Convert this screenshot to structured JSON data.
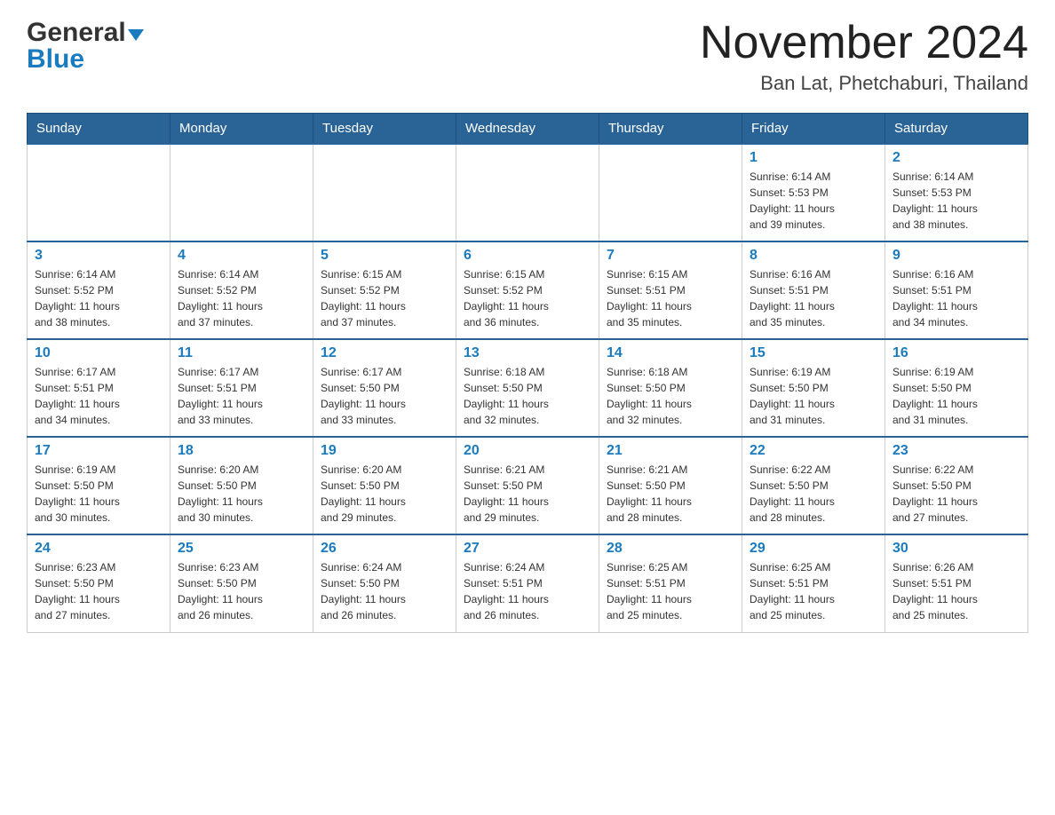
{
  "header": {
    "logo_line1": "General",
    "logo_line2": "Blue",
    "main_title": "November 2024",
    "subtitle": "Ban Lat, Phetchaburi, Thailand"
  },
  "days_of_week": [
    "Sunday",
    "Monday",
    "Tuesday",
    "Wednesday",
    "Thursday",
    "Friday",
    "Saturday"
  ],
  "weeks": [
    {
      "days": [
        {
          "number": "",
          "info": ""
        },
        {
          "number": "",
          "info": ""
        },
        {
          "number": "",
          "info": ""
        },
        {
          "number": "",
          "info": ""
        },
        {
          "number": "",
          "info": ""
        },
        {
          "number": "1",
          "info": "Sunrise: 6:14 AM\nSunset: 5:53 PM\nDaylight: 11 hours\nand 39 minutes."
        },
        {
          "number": "2",
          "info": "Sunrise: 6:14 AM\nSunset: 5:53 PM\nDaylight: 11 hours\nand 38 minutes."
        }
      ]
    },
    {
      "days": [
        {
          "number": "3",
          "info": "Sunrise: 6:14 AM\nSunset: 5:52 PM\nDaylight: 11 hours\nand 38 minutes."
        },
        {
          "number": "4",
          "info": "Sunrise: 6:14 AM\nSunset: 5:52 PM\nDaylight: 11 hours\nand 37 minutes."
        },
        {
          "number": "5",
          "info": "Sunrise: 6:15 AM\nSunset: 5:52 PM\nDaylight: 11 hours\nand 37 minutes."
        },
        {
          "number": "6",
          "info": "Sunrise: 6:15 AM\nSunset: 5:52 PM\nDaylight: 11 hours\nand 36 minutes."
        },
        {
          "number": "7",
          "info": "Sunrise: 6:15 AM\nSunset: 5:51 PM\nDaylight: 11 hours\nand 35 minutes."
        },
        {
          "number": "8",
          "info": "Sunrise: 6:16 AM\nSunset: 5:51 PM\nDaylight: 11 hours\nand 35 minutes."
        },
        {
          "number": "9",
          "info": "Sunrise: 6:16 AM\nSunset: 5:51 PM\nDaylight: 11 hours\nand 34 minutes."
        }
      ]
    },
    {
      "days": [
        {
          "number": "10",
          "info": "Sunrise: 6:17 AM\nSunset: 5:51 PM\nDaylight: 11 hours\nand 34 minutes."
        },
        {
          "number": "11",
          "info": "Sunrise: 6:17 AM\nSunset: 5:51 PM\nDaylight: 11 hours\nand 33 minutes."
        },
        {
          "number": "12",
          "info": "Sunrise: 6:17 AM\nSunset: 5:50 PM\nDaylight: 11 hours\nand 33 minutes."
        },
        {
          "number": "13",
          "info": "Sunrise: 6:18 AM\nSunset: 5:50 PM\nDaylight: 11 hours\nand 32 minutes."
        },
        {
          "number": "14",
          "info": "Sunrise: 6:18 AM\nSunset: 5:50 PM\nDaylight: 11 hours\nand 32 minutes."
        },
        {
          "number": "15",
          "info": "Sunrise: 6:19 AM\nSunset: 5:50 PM\nDaylight: 11 hours\nand 31 minutes."
        },
        {
          "number": "16",
          "info": "Sunrise: 6:19 AM\nSunset: 5:50 PM\nDaylight: 11 hours\nand 31 minutes."
        }
      ]
    },
    {
      "days": [
        {
          "number": "17",
          "info": "Sunrise: 6:19 AM\nSunset: 5:50 PM\nDaylight: 11 hours\nand 30 minutes."
        },
        {
          "number": "18",
          "info": "Sunrise: 6:20 AM\nSunset: 5:50 PM\nDaylight: 11 hours\nand 30 minutes."
        },
        {
          "number": "19",
          "info": "Sunrise: 6:20 AM\nSunset: 5:50 PM\nDaylight: 11 hours\nand 29 minutes."
        },
        {
          "number": "20",
          "info": "Sunrise: 6:21 AM\nSunset: 5:50 PM\nDaylight: 11 hours\nand 29 minutes."
        },
        {
          "number": "21",
          "info": "Sunrise: 6:21 AM\nSunset: 5:50 PM\nDaylight: 11 hours\nand 28 minutes."
        },
        {
          "number": "22",
          "info": "Sunrise: 6:22 AM\nSunset: 5:50 PM\nDaylight: 11 hours\nand 28 minutes."
        },
        {
          "number": "23",
          "info": "Sunrise: 6:22 AM\nSunset: 5:50 PM\nDaylight: 11 hours\nand 27 minutes."
        }
      ]
    },
    {
      "days": [
        {
          "number": "24",
          "info": "Sunrise: 6:23 AM\nSunset: 5:50 PM\nDaylight: 11 hours\nand 27 minutes."
        },
        {
          "number": "25",
          "info": "Sunrise: 6:23 AM\nSunset: 5:50 PM\nDaylight: 11 hours\nand 26 minutes."
        },
        {
          "number": "26",
          "info": "Sunrise: 6:24 AM\nSunset: 5:50 PM\nDaylight: 11 hours\nand 26 minutes."
        },
        {
          "number": "27",
          "info": "Sunrise: 6:24 AM\nSunset: 5:51 PM\nDaylight: 11 hours\nand 26 minutes."
        },
        {
          "number": "28",
          "info": "Sunrise: 6:25 AM\nSunset: 5:51 PM\nDaylight: 11 hours\nand 25 minutes."
        },
        {
          "number": "29",
          "info": "Sunrise: 6:25 AM\nSunset: 5:51 PM\nDaylight: 11 hours\nand 25 minutes."
        },
        {
          "number": "30",
          "info": "Sunrise: 6:26 AM\nSunset: 5:51 PM\nDaylight: 11 hours\nand 25 minutes."
        }
      ]
    }
  ]
}
